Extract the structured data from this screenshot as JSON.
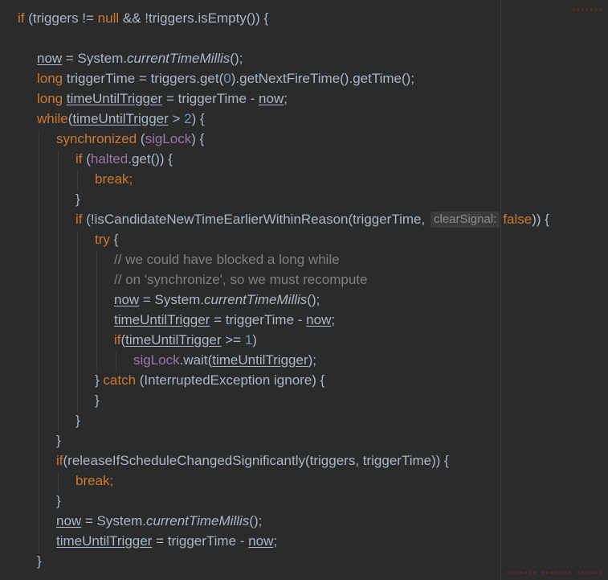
{
  "editor": {
    "lines": [
      {
        "indent": 0,
        "tokens": [
          {
            "t": "if",
            "c": "kw"
          },
          {
            "t": " (triggers != "
          },
          {
            "t": "null",
            "c": "kw"
          },
          {
            "t": " && !triggers.isEmpty()) {"
          }
        ]
      },
      {
        "indent": 0,
        "tokens": []
      },
      {
        "indent": 1,
        "tokens": [
          {
            "t": "now",
            "c": "under"
          },
          {
            "t": " = System."
          },
          {
            "t": "currentTimeMillis",
            "c": "ital"
          },
          {
            "t": "();"
          }
        ]
      },
      {
        "indent": 1,
        "tokens": [
          {
            "t": "long",
            "c": "kw"
          },
          {
            "t": " triggerTime = triggers.get("
          },
          {
            "t": "0",
            "c": "num"
          },
          {
            "t": ").getNextFireTime().getTime();"
          }
        ]
      },
      {
        "indent": 1,
        "tokens": [
          {
            "t": "long",
            "c": "kw"
          },
          {
            "t": " "
          },
          {
            "t": "timeUntilTrigger",
            "c": "under"
          },
          {
            "t": " = triggerTime - "
          },
          {
            "t": "now",
            "c": "under"
          },
          {
            "t": ";"
          }
        ]
      },
      {
        "indent": 1,
        "tokens": [
          {
            "t": "while",
            "c": "kw"
          },
          {
            "t": "("
          },
          {
            "t": "timeUntilTrigger",
            "c": "under"
          },
          {
            "t": " > "
          },
          {
            "t": "2",
            "c": "num"
          },
          {
            "t": ") {"
          }
        ]
      },
      {
        "indent": 2,
        "tokens": [
          {
            "t": "synchronized",
            "c": "kw"
          },
          {
            "t": " ("
          },
          {
            "t": "sigLock",
            "c": "fld"
          },
          {
            "t": ") {"
          }
        ]
      },
      {
        "indent": 3,
        "tokens": [
          {
            "t": "if",
            "c": "kw"
          },
          {
            "t": " ("
          },
          {
            "t": "halted",
            "c": "fld"
          },
          {
            "t": ".get()) {"
          }
        ]
      },
      {
        "indent": 4,
        "tokens": [
          {
            "t": "break;",
            "c": "kw"
          }
        ]
      },
      {
        "indent": 3,
        "tokens": [
          {
            "t": "}"
          }
        ]
      },
      {
        "indent": 3,
        "tokens": [
          {
            "t": "if",
            "c": "kw"
          },
          {
            "t": " (!isCandidateNewTimeEarlierWithinReason(triggerTime, "
          },
          {
            "t": "clearSignal:",
            "c": "hint"
          },
          {
            "t": "false",
            "c": "kw"
          },
          {
            "t": ")) {"
          }
        ]
      },
      {
        "indent": 4,
        "tokens": [
          {
            "t": "try",
            "c": "kw"
          },
          {
            "t": " {"
          }
        ]
      },
      {
        "indent": 5,
        "tokens": [
          {
            "t": "// we could have blocked a long while",
            "c": "cmt"
          }
        ]
      },
      {
        "indent": 5,
        "tokens": [
          {
            "t": "// on 'synchronize', so we must recompute",
            "c": "cmt"
          }
        ]
      },
      {
        "indent": 5,
        "tokens": [
          {
            "t": "now",
            "c": "under"
          },
          {
            "t": " = System."
          },
          {
            "t": "currentTimeMillis",
            "c": "ital"
          },
          {
            "t": "();"
          }
        ]
      },
      {
        "indent": 5,
        "tokens": [
          {
            "t": "timeUntilTrigger",
            "c": "under"
          },
          {
            "t": " = triggerTime - "
          },
          {
            "t": "now",
            "c": "under"
          },
          {
            "t": ";"
          }
        ]
      },
      {
        "indent": 5,
        "tokens": [
          {
            "t": "if",
            "c": "kw"
          },
          {
            "t": "("
          },
          {
            "t": "timeUntilTrigger",
            "c": "under"
          },
          {
            "t": " >= "
          },
          {
            "t": "1",
            "c": "num"
          },
          {
            "t": ")"
          }
        ]
      },
      {
        "indent": 6,
        "tokens": [
          {
            "t": "sigLock",
            "c": "fld"
          },
          {
            "t": ".wait("
          },
          {
            "t": "timeUntilTrigger",
            "c": "under"
          },
          {
            "t": ");"
          }
        ]
      },
      {
        "indent": 4,
        "tokens": [
          {
            "t": "} "
          },
          {
            "t": "catch",
            "c": "kw"
          },
          {
            "t": " (InterruptedException ignore) {"
          }
        ]
      },
      {
        "indent": 4,
        "tokens": [
          {
            "t": "}"
          }
        ]
      },
      {
        "indent": 3,
        "tokens": [
          {
            "t": "}"
          }
        ]
      },
      {
        "indent": 2,
        "tokens": [
          {
            "t": "}"
          }
        ]
      },
      {
        "indent": 2,
        "tokens": [
          {
            "t": "if",
            "c": "kw"
          },
          {
            "t": "(releaseIfScheduleChangedSignificantly(triggers, triggerTime)) {"
          }
        ]
      },
      {
        "indent": 3,
        "tokens": [
          {
            "t": "break;",
            "c": "kw"
          }
        ]
      },
      {
        "indent": 2,
        "tokens": [
          {
            "t": "}"
          }
        ]
      },
      {
        "indent": 2,
        "tokens": [
          {
            "t": "now",
            "c": "under"
          },
          {
            "t": " = System."
          },
          {
            "t": "currentTimeMillis",
            "c": "ital"
          },
          {
            "t": "();"
          }
        ]
      },
      {
        "indent": 2,
        "tokens": [
          {
            "t": "timeUntilTrigger",
            "c": "under"
          },
          {
            "t": " = triggerTime - "
          },
          {
            "t": "now",
            "c": "under"
          },
          {
            "t": ";"
          }
        ]
      },
      {
        "indent": 1,
        "tokens": [
          {
            "t": "}"
          }
        ]
      }
    ]
  },
  "colors": {
    "background": "#2b2b2b",
    "default_text": "#a9b7c6",
    "keyword": "#cc7832",
    "field": "#9876aa",
    "number": "#6897bb",
    "comment": "#808080"
  }
}
